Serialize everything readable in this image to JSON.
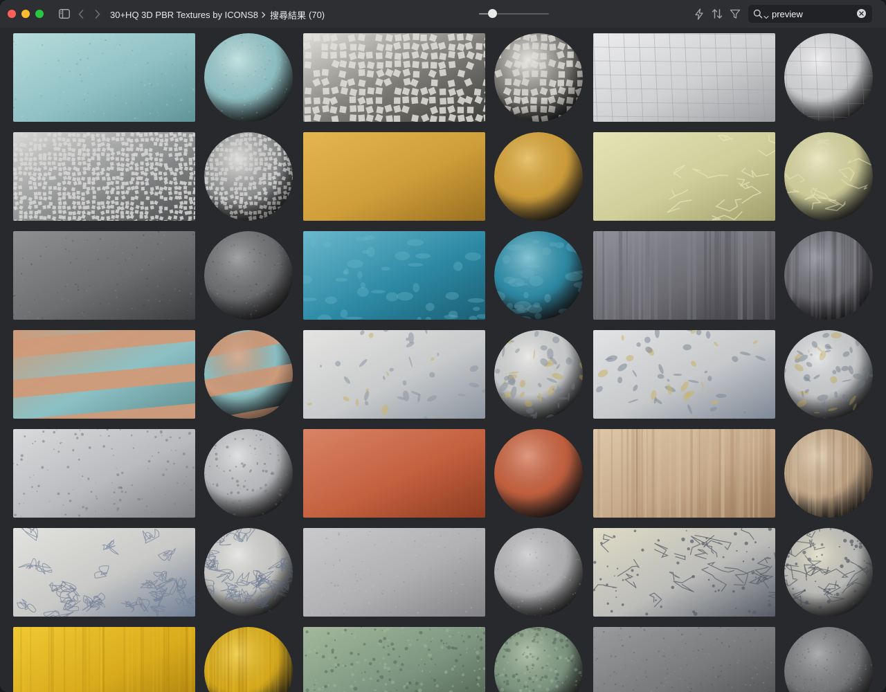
{
  "window": {
    "breadcrumb": {
      "folder": "30+HQ 3D PBR Textures by ICONS8",
      "current": "搜尋結果",
      "count": "(70)"
    },
    "zoom_level": 0.15,
    "search": {
      "value": "preview",
      "placeholder": ""
    }
  },
  "toolbar_icons": [
    "sidebar-toggle-icon",
    "chevron-left-icon",
    "chevron-right-icon",
    "lightning-icon",
    "sort-icon",
    "filter-icon",
    "search-icon",
    "clear-icon"
  ],
  "textures": [
    {
      "name": "light blue plaster",
      "base": "#8fc0c4",
      "light": "#b7dcdc",
      "dark": "#5f9497",
      "pattern": "speckle"
    },
    {
      "name": "white stone mosaic",
      "base": "#7b7a76",
      "light": "#e2e0da",
      "dark": "#3e3e3c",
      "pattern": "mosaic"
    },
    {
      "name": "white square tiles",
      "base": "#cfd0d2",
      "light": "#ececee",
      "dark": "#9c9da0",
      "pattern": "tiles"
    },
    {
      "name": "grey pebble mosaic",
      "base": "#8e8f91",
      "light": "#d8d8d6",
      "dark": "#4a4b4d",
      "pattern": "fine-mosaic"
    },
    {
      "name": "ochre yellow wall",
      "base": "#cf9e3a",
      "light": "#e4b650",
      "dark": "#9a7020",
      "pattern": "smooth"
    },
    {
      "name": "pale green cracked plaster",
      "base": "#cfcd99",
      "light": "#e6e4b6",
      "dark": "#a19f6c",
      "pattern": "cracks"
    },
    {
      "name": "dark grey concrete",
      "base": "#6d6e70",
      "light": "#8e8f91",
      "dark": "#3c3d3f",
      "pattern": "speckle"
    },
    {
      "name": "teal painted wall",
      "base": "#2d8aa5",
      "light": "#6bb8cc",
      "dark": "#1b5f74",
      "pattern": "blotch"
    },
    {
      "name": "rusty steel plate",
      "base": "#6c6c72",
      "light": "#8f9099",
      "dark": "#3e3e44",
      "pattern": "streaks"
    },
    {
      "name": "striped painted wall",
      "base": "#8cc1c5",
      "light": "#d09a78",
      "dark": "#5e8d90",
      "pattern": "stripes"
    },
    {
      "name": "peeling paint wall",
      "base": "#c8cacb",
      "light": "#e4e4e2",
      "dark": "#8c95a0",
      "pattern": "peel"
    },
    {
      "name": "chipped paint surface",
      "base": "#c6c8ca",
      "light": "#e2e3e4",
      "dark": "#7e8897",
      "pattern": "chips"
    },
    {
      "name": "pitted white concrete",
      "base": "#b9babd",
      "light": "#d9dadc",
      "dark": "#7d7e81",
      "pattern": "pits"
    },
    {
      "name": "terracotta plaster",
      "base": "#c3603e",
      "light": "#d98466",
      "dark": "#8e3c22",
      "pattern": "smooth"
    },
    {
      "name": "weathered rusty paint",
      "base": "#c5a98a",
      "light": "#ddc7a8",
      "dark": "#9a7a5a",
      "pattern": "streaks"
    },
    {
      "name": "blue camo worn paint",
      "base": "#c8c8c6",
      "light": "#e2e2df",
      "dark": "#6f7e95",
      "pattern": "camo"
    },
    {
      "name": "grey rough concrete",
      "base": "#b0b0b2",
      "light": "#cacacc",
      "dark": "#838386",
      "pattern": "speckle"
    },
    {
      "name": "cracked yellowed plaster",
      "base": "#bcbcba",
      "light": "#dedbc4",
      "dark": "#565c66",
      "pattern": "crackle"
    },
    {
      "name": "yellow brushed metal",
      "base": "#d8aa1c",
      "light": "#f0c834",
      "dark": "#a47a0c",
      "pattern": "brushed"
    },
    {
      "name": "green moss ground",
      "base": "#7d9580",
      "light": "#a3b89c",
      "dark": "#4b5e4d",
      "pattern": "moss"
    },
    {
      "name": "dark asphalt",
      "base": "#77787a",
      "light": "#9a9b9d",
      "dark": "#4a4b4d",
      "pattern": "grain"
    }
  ]
}
